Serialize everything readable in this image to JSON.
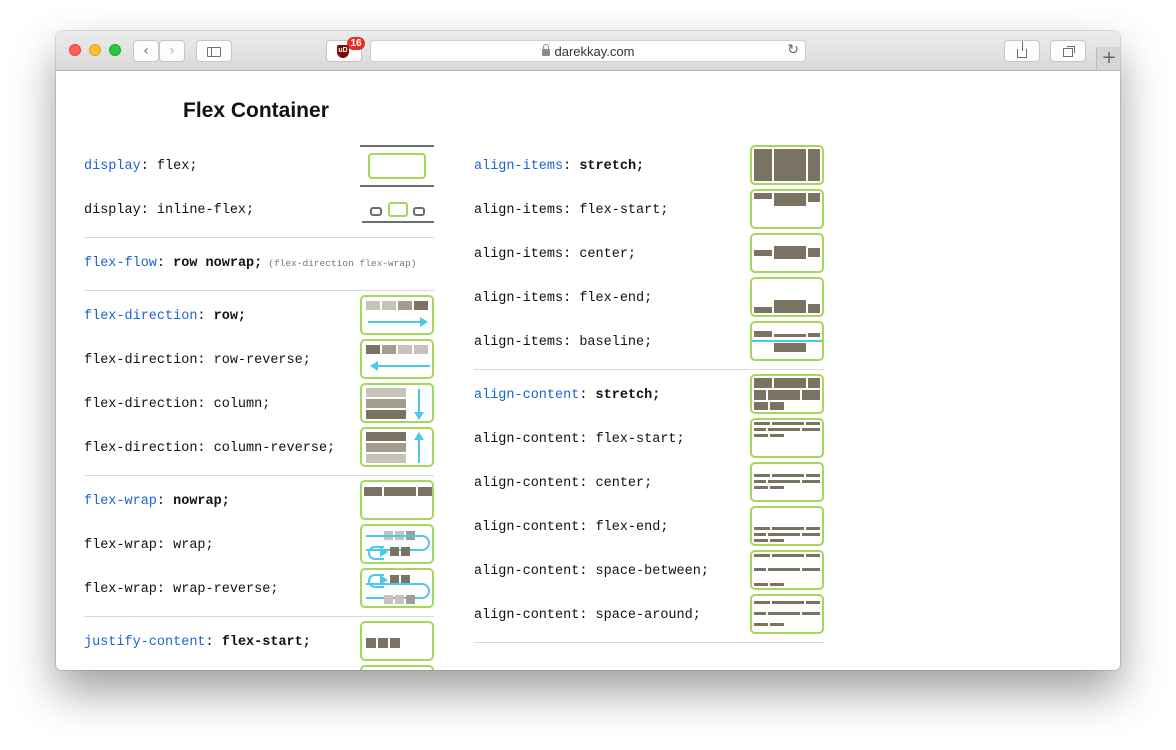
{
  "browser": {
    "url": "darekkay.com",
    "extension_badge": "16",
    "extension_label": "uD",
    "back_icon": "chevron-left-icon",
    "forward_icon": "chevron-right-icon",
    "sidebar_icon": "sidebar-icon",
    "share_icon": "share-icon",
    "tabs_icon": "tabs-icon",
    "new_tab_icon": "plus-icon"
  },
  "page": {
    "title": "Flex Container"
  },
  "left": {
    "display": {
      "prop": "display",
      "sep": ":",
      "value": " flex;"
    },
    "display_inline": {
      "text": "display: inline-flex;"
    },
    "flex_flow": {
      "prop": "flex-flow",
      "sep": ":",
      "value": " row nowrap;",
      "note": "(flex-direction flex-wrap)"
    },
    "flex_direction": {
      "prop": "flex-direction",
      "sep": ":",
      "value": " row;"
    },
    "flex_direction_rows": [
      "flex-direction: row-reverse;",
      "flex-direction: column;",
      "flex-direction: column-reverse;"
    ],
    "flex_wrap": {
      "prop": "flex-wrap",
      "sep": ":",
      "value": " nowrap;"
    },
    "flex_wrap_rows": [
      "flex-wrap: wrap;",
      "flex-wrap: wrap-reverse;"
    ],
    "justify_content": {
      "prop": "justify-content",
      "sep": ":",
      "value": " flex-start;"
    }
  },
  "right": {
    "align_items": {
      "prop": "align-items",
      "sep": ":",
      "value": " stretch;"
    },
    "align_items_rows": [
      "align-items: flex-start;",
      "align-items: center;",
      "align-items: flex-end;",
      "align-items: baseline;"
    ],
    "align_content": {
      "prop": "align-content",
      "sep": ":",
      "value": " stretch;"
    },
    "align_content_rows": [
      "align-content: flex-start;",
      "align-content: center;",
      "align-content: flex-end;",
      "align-content: space-between;",
      "align-content: space-around;"
    ]
  },
  "colors": {
    "property_blue": "#1a63d9",
    "box_border_green": "#a6d65a",
    "item_dark": "#7a7363",
    "arrow_cyan": "#4bc9e6"
  }
}
